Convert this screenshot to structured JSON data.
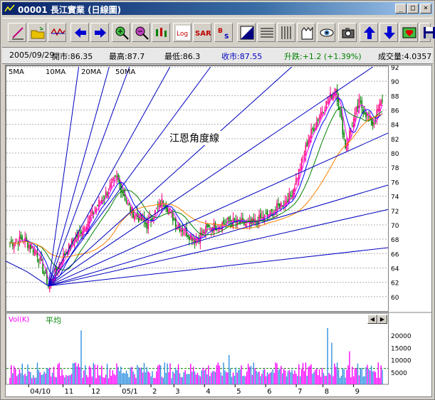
{
  "window": {
    "title": "00001 長江實業 (日線圖)",
    "minimize": "_",
    "maximize": "□",
    "close": "×"
  },
  "toolbar": {
    "items": [
      "pen-icon",
      "open-folder-icon",
      "wave-icon",
      "arrow-left-icon",
      "arrow-right-icon",
      "zoom-in-icon",
      "zoom-out-icon",
      "candlestick-icon",
      "log-icon",
      "sar-icon",
      "b-s-icon",
      "contrast-icon",
      "grid-icon",
      "columns-icon",
      "hands-icon",
      "eye-icon",
      "camera-icon",
      "arrow-up-icon",
      "arrow-down-icon",
      "heart-icon",
      "disk-icon"
    ],
    "log_label": "Log",
    "sar_label": "SAR",
    "bs_label_b": "B",
    "bs_label_s": "S"
  },
  "info_bar": {
    "date": "2005/09/29",
    "open": "開市:86.35",
    "high": "最高:87.7",
    "low": "最低:86.3",
    "close": "收市:87.55",
    "change": "升跌:+1.2 (+1.39%)",
    "volume": "成交量:4.0357"
  },
  "colors": {
    "ma5": "#ff00ff",
    "ma10": "#0000ff",
    "ma20": "#008000",
    "ma50": "#ff8000",
    "up": "#ff0080",
    "down": "#008000",
    "gann": "#0000c0"
  },
  "legend": {
    "ma5": "5MA",
    "ma10": "10MA",
    "ma20": "20MA",
    "ma50": "50MA"
  },
  "annotation": "江恩角度線",
  "volume_panel": {
    "label": "Vol(K)",
    "avg_label": "平均"
  },
  "chart_data": [
    {
      "type": "candlestick",
      "title": "",
      "ylim": [
        58,
        92
      ],
      "yticks": [
        60,
        62,
        64,
        66,
        68,
        70,
        72,
        74,
        76,
        78,
        80,
        82,
        84,
        86,
        88,
        90,
        92
      ],
      "xticks": [
        "04/10",
        "11",
        "12",
        "05/1",
        "2",
        "3",
        "4",
        "5",
        "6",
        "7",
        "8",
        "9"
      ],
      "ma_series": [
        "5MA",
        "10MA",
        "20MA",
        "50MA"
      ],
      "anchor_points": [
        {
          "x": 0,
          "y": 67.5
        },
        {
          "x": 10,
          "y": 68
        },
        {
          "x": 20,
          "y": 66
        },
        {
          "x": 28,
          "y": 61.5
        },
        {
          "x": 40,
          "y": 66
        },
        {
          "x": 55,
          "y": 70
        },
        {
          "x": 65,
          "y": 73
        },
        {
          "x": 78,
          "y": 76.5
        },
        {
          "x": 88,
          "y": 72
        },
        {
          "x": 100,
          "y": 70
        },
        {
          "x": 112,
          "y": 73.5
        },
        {
          "x": 122,
          "y": 70
        },
        {
          "x": 135,
          "y": 68
        },
        {
          "x": 145,
          "y": 69.5
        },
        {
          "x": 160,
          "y": 70.5
        },
        {
          "x": 175,
          "y": 70
        },
        {
          "x": 190,
          "y": 71.5
        },
        {
          "x": 205,
          "y": 74
        },
        {
          "x": 212,
          "y": 78
        },
        {
          "x": 218,
          "y": 82
        },
        {
          "x": 228,
          "y": 86
        },
        {
          "x": 238,
          "y": 89
        },
        {
          "x": 245,
          "y": 81
        },
        {
          "x": 255,
          "y": 87
        },
        {
          "x": 265,
          "y": 84
        },
        {
          "x": 272,
          "y": 87.5
        }
      ]
    },
    {
      "type": "bar",
      "title": "",
      "ylabel": "Vol(K)",
      "ylim": [
        0,
        25000
      ],
      "yticks": [
        5000,
        10000,
        15000,
        20000
      ],
      "average": 6500,
      "spikes": [
        {
          "x": 52,
          "value": 22000
        },
        {
          "x": 160,
          "value": 12000
        },
        {
          "x": 232,
          "value": 23000
        },
        {
          "x": 248,
          "value": 13500
        },
        {
          "x": 235,
          "value": 17000
        }
      ]
    }
  ]
}
